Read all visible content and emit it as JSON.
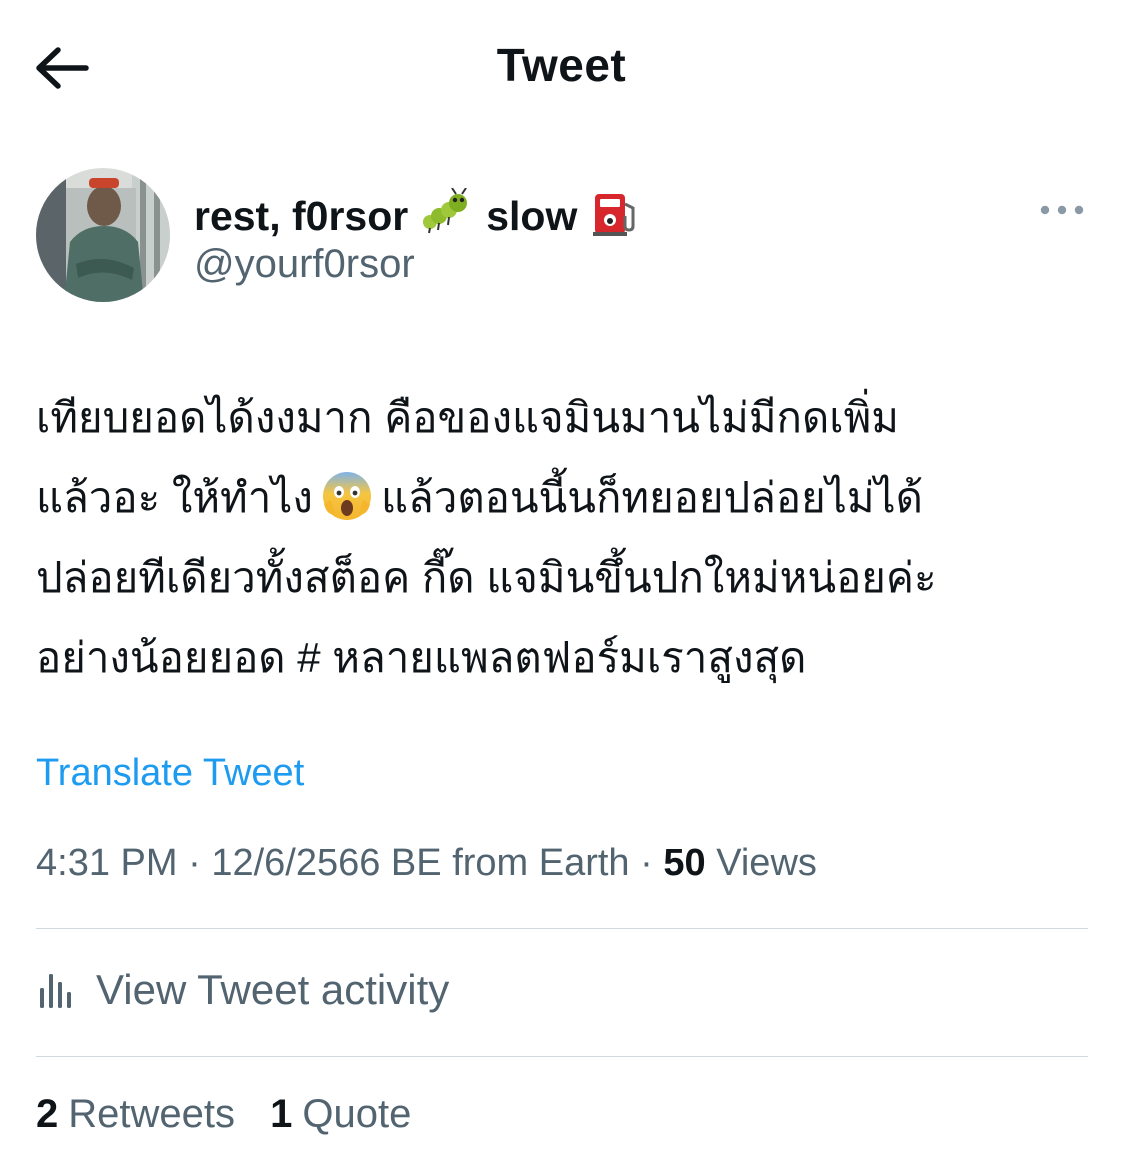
{
  "header": {
    "title": "Tweet",
    "back_icon": "arrow-left-icon"
  },
  "author": {
    "name_part1": "rest, f0rsor",
    "name_emoji1": "caterpillar-emoji",
    "name_part2": "slow",
    "name_emoji2": "fuel-pump-emoji",
    "handle": "@yourf0rsor",
    "more_icon": "more-dots-icon"
  },
  "tweet": {
    "line1": "เทียบยอดได้งงมาก คือของแจมินมานไม่มีกดเพิ่ม",
    "line2_before": "แล้วอะ ให้ทำไง",
    "line2_emoji": "face-screaming-in-fear-emoji",
    "line2_after": "แล้วตอนนี้นก็ทยอยปล่อยไม่ได้",
    "line3": "ปล่อยทีเดียวทั้งสต็อค กี๊ด แจมินขึ้นปกใหม่หน่อยค่ะ",
    "line4": "อย่างน้อยยอด # หลายแพลตฟอร์มเราสูงสุด"
  },
  "translate_label": "Translate Tweet",
  "meta": {
    "time": "4:31 PM",
    "date": "12/6/2566 BE",
    "source": "from Earth",
    "views_count": "50",
    "views_label": "Views"
  },
  "activity": {
    "label": "View Tweet activity",
    "icon": "bar-chart-icon"
  },
  "stats": {
    "retweets_count": "2",
    "retweets_label": "Retweets",
    "quotes_count": "1",
    "quotes_label": "Quote"
  },
  "colors": {
    "link_blue": "#1d9bf0",
    "secondary_text": "#536471",
    "primary_text": "#0f1419",
    "divider": "#cfd9de"
  }
}
